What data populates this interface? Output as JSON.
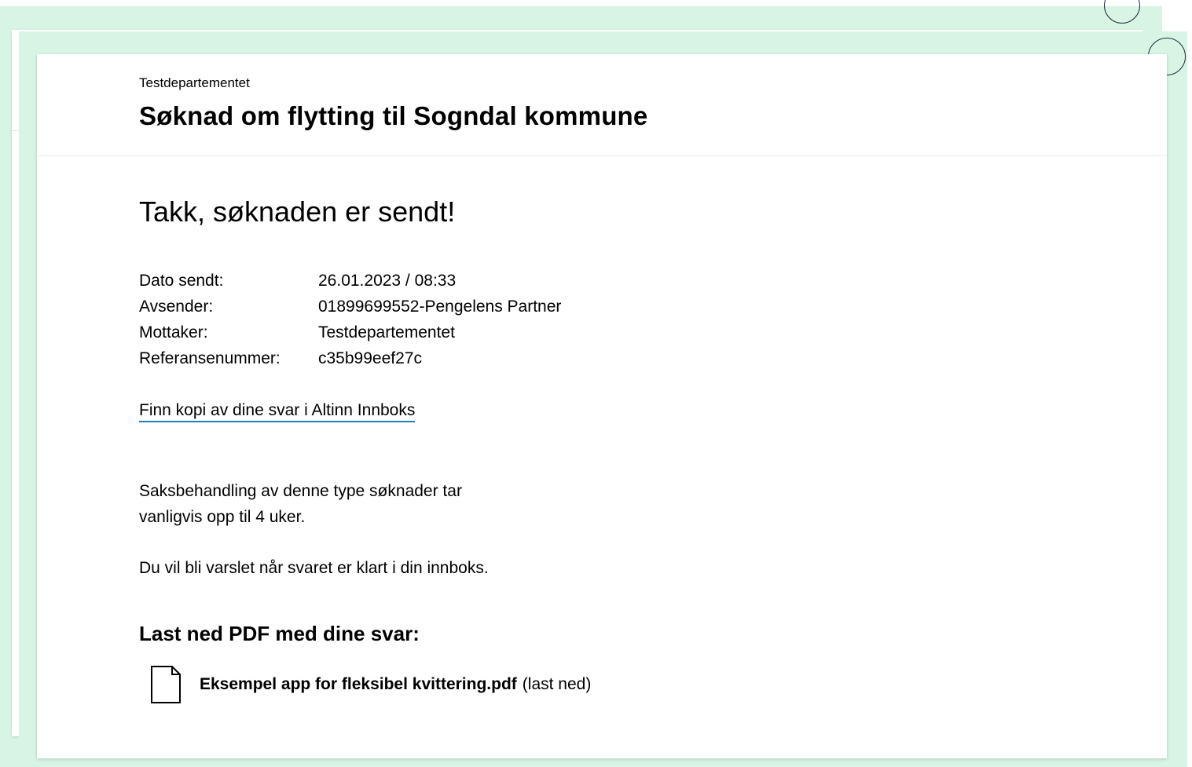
{
  "header": {
    "organization": "Testdepartementet",
    "title": "Søknad om flytting til Sogndal kommune"
  },
  "receipt": {
    "heading": "Takk, søknaden er sendt!",
    "details": [
      {
        "label": "Dato sendt:",
        "value": "26.01.2023 / 08:33"
      },
      {
        "label": "Avsender:",
        "value": "01899699552-Pengelens Partner"
      },
      {
        "label": "Mottaker:",
        "value": "Testdepartementet"
      },
      {
        "label": "Referansenummer:",
        "value": "c35b99eef27c"
      }
    ],
    "inbox_link": "Finn kopi av dine svar i Altinn Innboks",
    "processing_text": "Saksbehandling av denne type søknader tar vanligvis opp til 4 uker.",
    "notify_text": "Du vil bli varslet når svaret er klart i din innboks.",
    "pdf_heading": "Last ned PDF med dine svar:",
    "file": {
      "name": "Eksempel app for fleksibel kvittering.pdf",
      "action": "(last ned)",
      "icon": "document-icon"
    }
  },
  "colors": {
    "background": "#d8f4e4",
    "link_underline": "#1a7ec1",
    "close_button_border": "#1e2b3c"
  }
}
